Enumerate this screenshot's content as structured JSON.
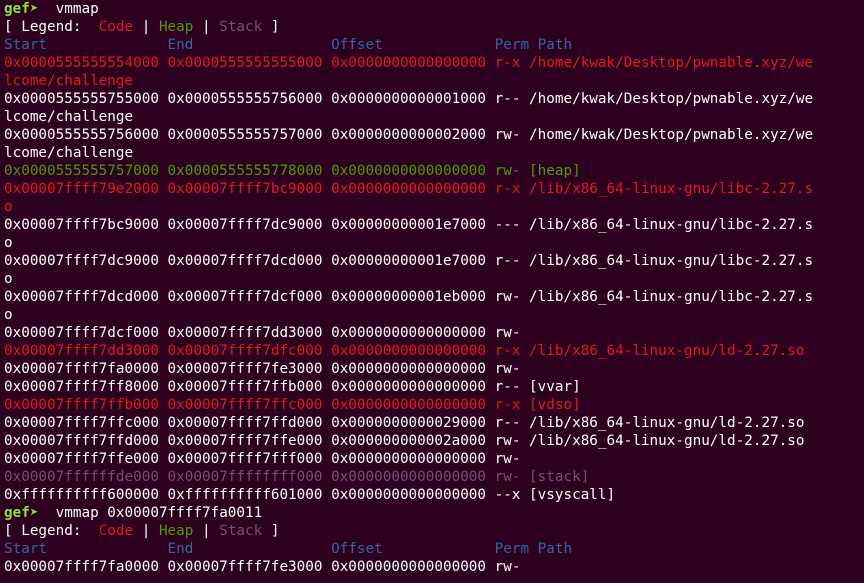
{
  "colors": {
    "background": "#2c001e",
    "default": "#ffffff",
    "code": "#e01b24",
    "heap": "#4e9a06",
    "stack": "#75507b",
    "header": "#3465a4",
    "prompt": "#8ae234"
  },
  "terminal": {
    "lines": [
      {
        "segments": [
          {
            "text": "gef➤  ",
            "color": "prompt",
            "bold": true
          },
          {
            "text": "vmmap",
            "color": "default"
          }
        ]
      },
      {
        "segments": [
          {
            "text": "[ Legend:  ",
            "color": "default"
          },
          {
            "text": "Code",
            "color": "code"
          },
          {
            "text": " | ",
            "color": "default"
          },
          {
            "text": "Heap",
            "color": "heap"
          },
          {
            "text": " | ",
            "color": "default"
          },
          {
            "text": "Stack",
            "color": "stack"
          },
          {
            "text": " ]",
            "color": "default"
          }
        ]
      },
      {
        "segments": [
          {
            "text": "Start              End                Offset             Perm Path",
            "color": "header"
          }
        ]
      },
      {
        "segments": [
          {
            "text": "0x0000555555554000 0x0000555555555000 0x0000000000000000 r-x /home/kwak/Desktop/pwnable.xyz/we",
            "color": "code"
          }
        ]
      },
      {
        "segments": [
          {
            "text": "lcome/challenge",
            "color": "code"
          }
        ]
      },
      {
        "segments": [
          {
            "text": "0x0000555555755000 0x0000555555756000 0x0000000000001000 r-- /home/kwak/Desktop/pwnable.xyz/we",
            "color": "default"
          }
        ]
      },
      {
        "segments": [
          {
            "text": "lcome/challenge",
            "color": "default"
          }
        ]
      },
      {
        "segments": [
          {
            "text": "0x0000555555756000 0x0000555555757000 0x0000000000002000 rw- /home/kwak/Desktop/pwnable.xyz/we",
            "color": "default"
          }
        ]
      },
      {
        "segments": [
          {
            "text": "lcome/challenge",
            "color": "default"
          }
        ]
      },
      {
        "segments": [
          {
            "text": "0x0000555555757000 0x0000555555778000 0x0000000000000000 rw- [heap]",
            "color": "heap"
          }
        ]
      },
      {
        "segments": [
          {
            "text": "0x00007ffff79e2000 0x00007ffff7bc9000 0x0000000000000000 r-x /lib/x86_64-linux-gnu/libc-2.27.s",
            "color": "code"
          }
        ]
      },
      {
        "segments": [
          {
            "text": "o",
            "color": "code"
          }
        ]
      },
      {
        "segments": [
          {
            "text": "0x00007ffff7bc9000 0x00007ffff7dc9000 0x00000000001e7000 --- /lib/x86_64-linux-gnu/libc-2.27.s",
            "color": "default"
          }
        ]
      },
      {
        "segments": [
          {
            "text": "o",
            "color": "default"
          }
        ]
      },
      {
        "segments": [
          {
            "text": "0x00007ffff7dc9000 0x00007ffff7dcd000 0x00000000001e7000 r-- /lib/x86_64-linux-gnu/libc-2.27.s",
            "color": "default"
          }
        ]
      },
      {
        "segments": [
          {
            "text": "o",
            "color": "default"
          }
        ]
      },
      {
        "segments": [
          {
            "text": "0x00007ffff7dcd000 0x00007ffff7dcf000 0x00000000001eb000 rw- /lib/x86_64-linux-gnu/libc-2.27.s",
            "color": "default"
          }
        ]
      },
      {
        "segments": [
          {
            "text": "o",
            "color": "default"
          }
        ]
      },
      {
        "segments": [
          {
            "text": "0x00007ffff7dcf000 0x00007ffff7dd3000 0x0000000000000000 rw-",
            "color": "default"
          }
        ]
      },
      {
        "segments": [
          {
            "text": "0x00007ffff7dd3000 0x00007ffff7dfc000 0x0000000000000000 r-x /lib/x86_64-linux-gnu/ld-2.27.so",
            "color": "code"
          }
        ]
      },
      {
        "segments": [
          {
            "text": "0x00007ffff7fa0000 0x00007ffff7fe3000 0x0000000000000000 rw-",
            "color": "default"
          }
        ]
      },
      {
        "segments": [
          {
            "text": "0x00007ffff7ff8000 0x00007ffff7ffb000 0x0000000000000000 r-- [vvar]",
            "color": "default"
          }
        ]
      },
      {
        "segments": [
          {
            "text": "0x00007ffff7ffb000 0x00007ffff7ffc000 0x0000000000000000 r-x [vdso]",
            "color": "code"
          }
        ]
      },
      {
        "segments": [
          {
            "text": "0x00007ffff7ffc000 0x00007ffff7ffd000 0x0000000000029000 r-- /lib/x86_64-linux-gnu/ld-2.27.so",
            "color": "default"
          }
        ]
      },
      {
        "segments": [
          {
            "text": "0x00007ffff7ffd000 0x00007ffff7ffe000 0x000000000002a000 rw- /lib/x86_64-linux-gnu/ld-2.27.so",
            "color": "default"
          }
        ]
      },
      {
        "segments": [
          {
            "text": "0x00007ffff7ffe000 0x00007ffff7fff000 0x0000000000000000 rw-",
            "color": "default"
          }
        ]
      },
      {
        "segments": [
          {
            "text": "0x00007ffffffde000 0x00007ffffffff000 0x0000000000000000 rw- [stack]",
            "color": "stack"
          }
        ]
      },
      {
        "segments": [
          {
            "text": "0xffffffffff600000 0xffffffffff601000 0x0000000000000000 --x [vsyscall]",
            "color": "default"
          }
        ]
      },
      {
        "segments": [
          {
            "text": "gef➤  ",
            "color": "prompt",
            "bold": true
          },
          {
            "text": "vmmap 0x00007ffff7fa0011",
            "color": "default"
          }
        ]
      },
      {
        "segments": [
          {
            "text": "[ Legend:  ",
            "color": "default"
          },
          {
            "text": "Code",
            "color": "code"
          },
          {
            "text": " | ",
            "color": "default"
          },
          {
            "text": "Heap",
            "color": "heap"
          },
          {
            "text": " | ",
            "color": "default"
          },
          {
            "text": "Stack",
            "color": "stack"
          },
          {
            "text": " ]",
            "color": "default"
          }
        ]
      },
      {
        "segments": [
          {
            "text": "Start              End                Offset             Perm Path",
            "color": "header"
          }
        ]
      },
      {
        "segments": [
          {
            "text": "0x00007ffff7fa0000 0x00007ffff7fe3000 0x0000000000000000 rw-",
            "color": "default"
          }
        ]
      }
    ]
  }
}
